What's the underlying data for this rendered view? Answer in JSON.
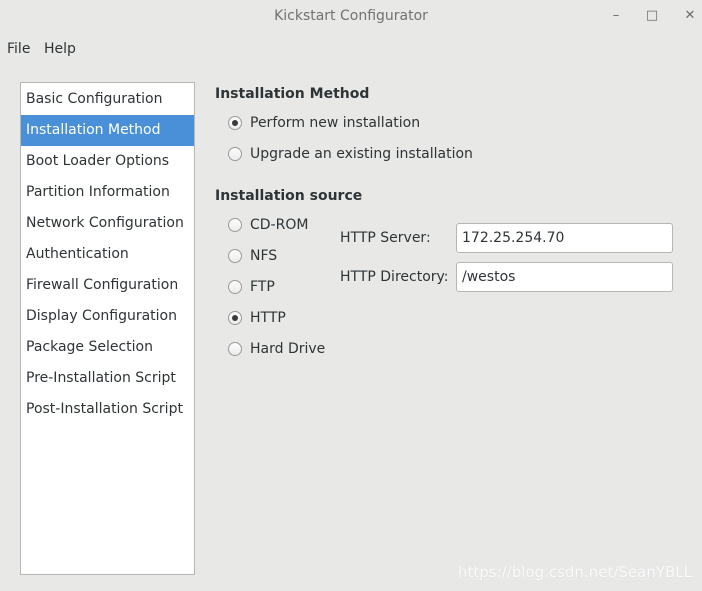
{
  "window": {
    "title": "Kickstart Configurator",
    "minimize_glyph": "–",
    "maximize_glyph": "□",
    "close_glyph": "✕"
  },
  "menubar": {
    "file": "File",
    "help": "Help"
  },
  "sidebar": {
    "selected_index": 1,
    "items": [
      {
        "label": "Basic Configuration"
      },
      {
        "label": "Installation Method"
      },
      {
        "label": "Boot Loader Options"
      },
      {
        "label": "Partition Information"
      },
      {
        "label": "Network Configuration"
      },
      {
        "label": "Authentication"
      },
      {
        "label": "Firewall Configuration"
      },
      {
        "label": "Display Configuration"
      },
      {
        "label": "Package Selection"
      },
      {
        "label": "Pre-Installation Script"
      },
      {
        "label": "Post-Installation Script"
      }
    ]
  },
  "install_method": {
    "heading": "Installation Method",
    "options": [
      {
        "label": "Perform new installation",
        "checked": true
      },
      {
        "label": "Upgrade an existing installation",
        "checked": false
      }
    ]
  },
  "install_source": {
    "heading": "Installation source",
    "options": [
      {
        "label": "CD-ROM",
        "checked": false
      },
      {
        "label": "NFS",
        "checked": false
      },
      {
        "label": "FTP",
        "checked": false
      },
      {
        "label": "HTTP",
        "checked": true
      },
      {
        "label": "Hard Drive",
        "checked": false
      }
    ],
    "http_server_label": "HTTP Server:",
    "http_server_value": "172.25.254.70",
    "http_directory_label": "HTTP Directory:",
    "http_directory_value": "/westos"
  },
  "watermark": "https://blog.csdn.net/SeanYBLL"
}
